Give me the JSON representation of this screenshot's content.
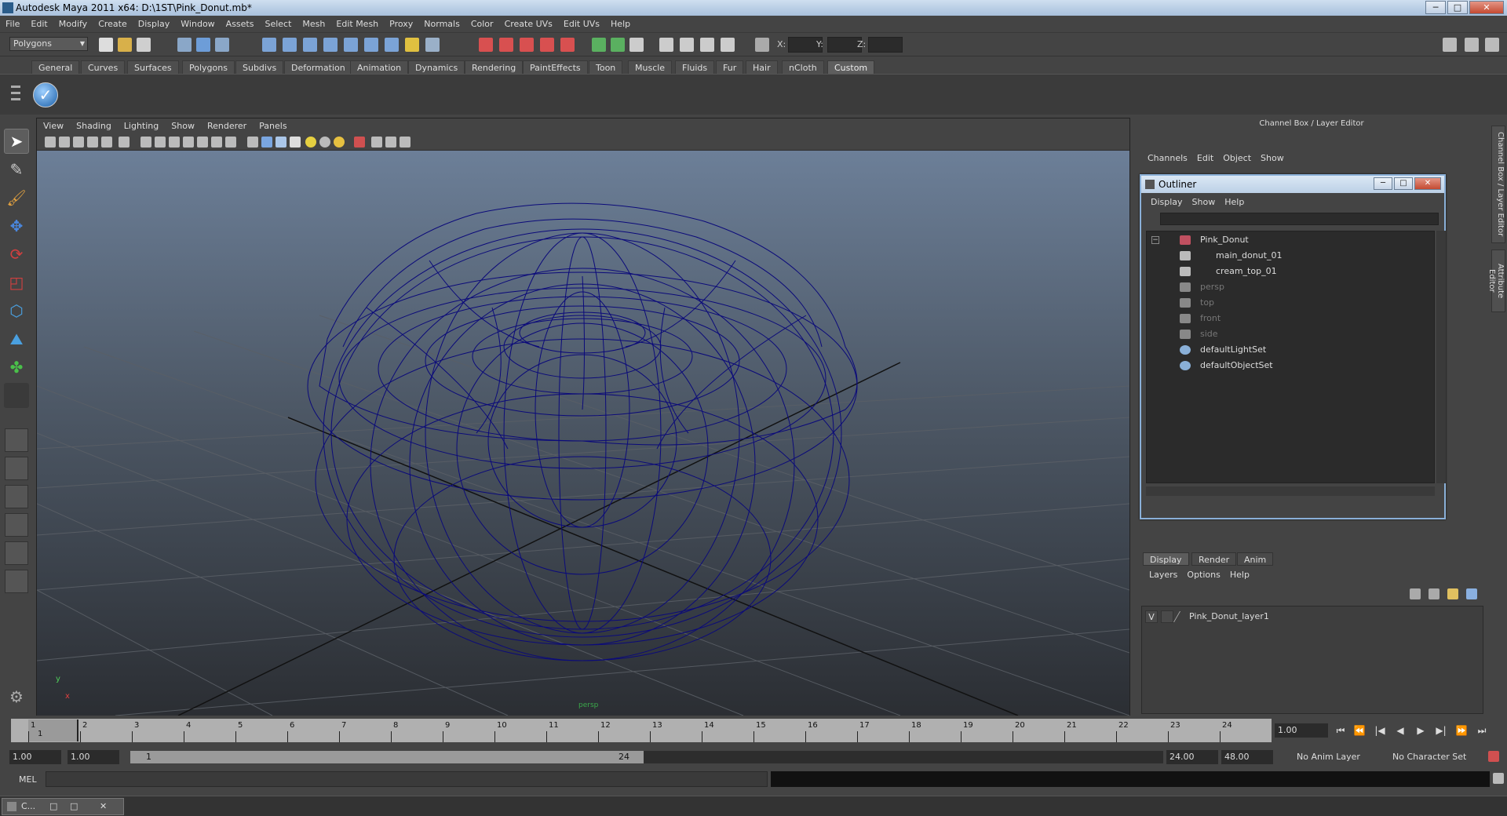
{
  "window": {
    "title": "Autodesk Maya 2011 x64: D:\\1ST\\Pink_Donut.mb*",
    "minimize": "─",
    "maximize": "□",
    "close": "✕"
  },
  "menubar": [
    "File",
    "Edit",
    "Modify",
    "Create",
    "Display",
    "Window",
    "Assets",
    "Select",
    "Mesh",
    "Edit Mesh",
    "Proxy",
    "Normals",
    "Color",
    "Create UVs",
    "Edit UVs",
    "Help"
  ],
  "statusline": {
    "mode": "Polygons",
    "x_label": "X:",
    "y_label": "Y:",
    "z_label": "Z:"
  },
  "shelf": {
    "tabs": [
      "General",
      "Curves",
      "Surfaces",
      "Polygons",
      "Subdivs",
      "Deformation",
      "Animation",
      "Dynamics",
      "Rendering",
      "PaintEffects",
      "Toon",
      "Muscle",
      "Fluids",
      "Fur",
      "Hair",
      "nCloth",
      "Custom"
    ],
    "active": "Custom",
    "button_glyph": "✓"
  },
  "viewport": {
    "menus": [
      "View",
      "Shading",
      "Lighting",
      "Show",
      "Renderer",
      "Panels"
    ],
    "camera_label": "persp",
    "axis_x": "x",
    "axis_y": "y",
    "wire_color": "#0b0a7a"
  },
  "channelbox": {
    "title": "Channel Box / Layer Editor",
    "menus": [
      "Channels",
      "Edit",
      "Object",
      "Show"
    ]
  },
  "outliner": {
    "title": "Outliner",
    "menus": [
      "Display",
      "Show",
      "Help"
    ],
    "items": [
      {
        "label": "Pink_Donut",
        "indent": 0,
        "dim": false,
        "expand": "−"
      },
      {
        "label": "main_donut_01",
        "indent": 1,
        "dim": false
      },
      {
        "label": "cream_top_01",
        "indent": 1,
        "dim": false
      },
      {
        "label": "persp",
        "indent": 0,
        "dim": true
      },
      {
        "label": "top",
        "indent": 0,
        "dim": true
      },
      {
        "label": "front",
        "indent": 0,
        "dim": true
      },
      {
        "label": "side",
        "indent": 0,
        "dim": true
      },
      {
        "label": "defaultLightSet",
        "indent": 0,
        "dim": false
      },
      {
        "label": "defaultObjectSet",
        "indent": 0,
        "dim": false
      }
    ]
  },
  "layereditor": {
    "tabs": [
      "Display",
      "Render",
      "Anim"
    ],
    "active": "Display",
    "menus": [
      "Layers",
      "Options",
      "Help"
    ],
    "layer": {
      "visible": "V",
      "name": "Pink_Donut_layer1"
    }
  },
  "sidetabs": [
    "Channel Box / Layer Editor",
    "Attribute Editor"
  ],
  "timeslider": {
    "ticks": [
      "1",
      "2",
      "3",
      "4",
      "5",
      "6",
      "7",
      "8",
      "9",
      "10",
      "11",
      "12",
      "13",
      "14",
      "15",
      "16",
      "17",
      "18",
      "19",
      "20",
      "21",
      "22",
      "23",
      "24"
    ],
    "current": "1",
    "current_field": "1.00",
    "playback": [
      "⏮",
      "⏪",
      "|◀",
      "◀",
      "▶",
      "▶|",
      "⏩",
      "⏭"
    ]
  },
  "rangeslider": {
    "start": "1.00",
    "playstart": "1.00",
    "handle_start": "1",
    "handle_end": "24",
    "playend": "24.00",
    "end": "48.00",
    "anim_layer": "No Anim Layer",
    "char_set": "No Character Set"
  },
  "commandline": {
    "label": "MEL"
  },
  "taskbar": {
    "item": "C..."
  }
}
